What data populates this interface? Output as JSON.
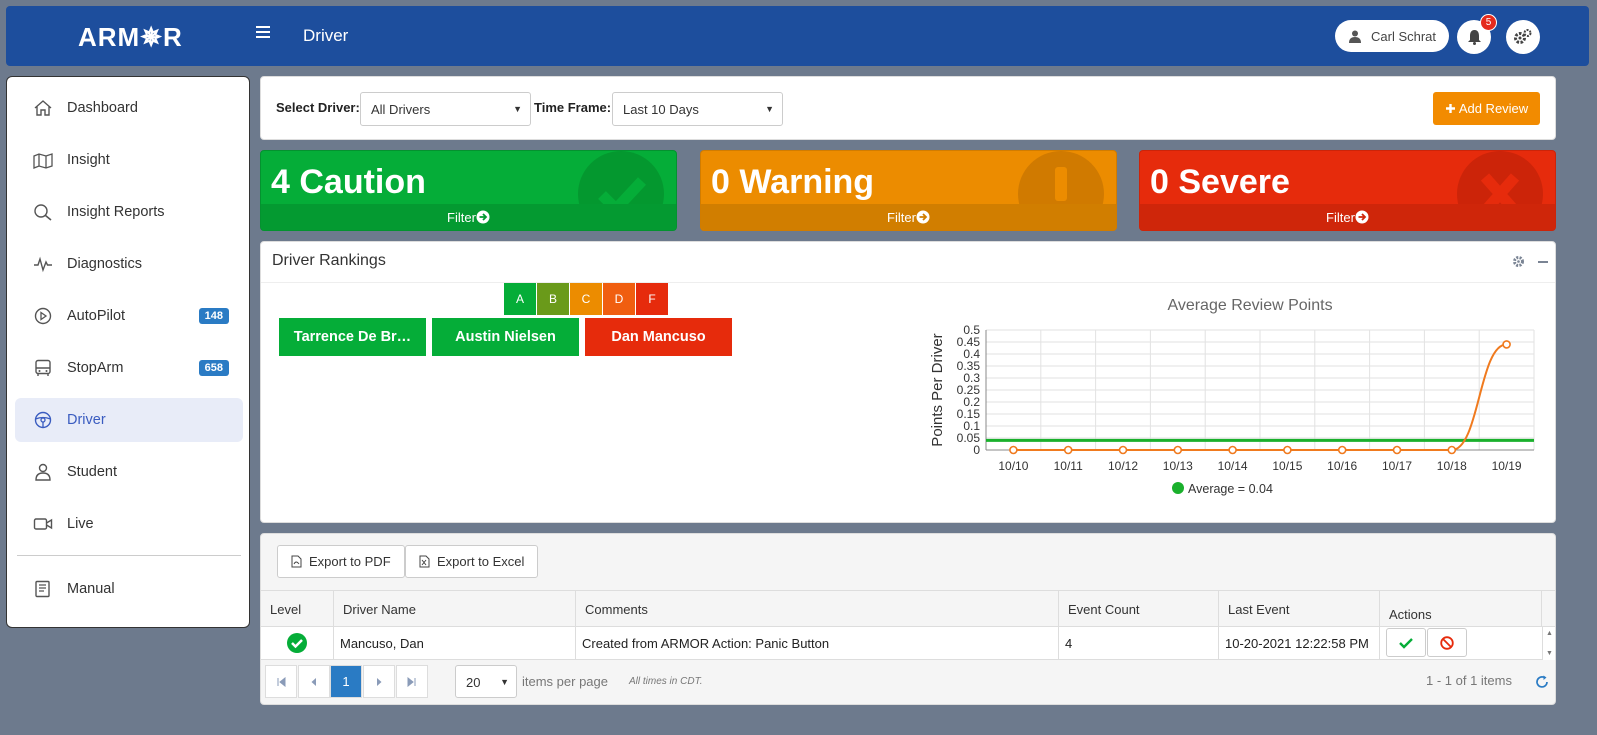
{
  "header": {
    "logo": "ARM✵R",
    "page_title": "Driver",
    "user_name": "Carl Schrat",
    "notification_count": "5"
  },
  "sidebar": {
    "items": [
      {
        "label": "Dashboard",
        "icon": "home-icon"
      },
      {
        "label": "Insight",
        "icon": "map-icon"
      },
      {
        "label": "Insight Reports",
        "icon": "search-icon"
      },
      {
        "label": "Diagnostics",
        "icon": "pulse-icon"
      },
      {
        "label": "AutoPilot",
        "icon": "play-circle-icon",
        "badge": "148"
      },
      {
        "label": "StopArm",
        "icon": "bus-icon",
        "badge": "658"
      },
      {
        "label": "Driver",
        "icon": "steering-wheel-icon",
        "active": true
      },
      {
        "label": "Student",
        "icon": "student-icon"
      },
      {
        "label": "Live",
        "icon": "video-camera-icon"
      },
      {
        "label": "Manual",
        "icon": "book-icon"
      }
    ]
  },
  "filters": {
    "driver_label": "Select Driver:",
    "driver_value": "All Drivers",
    "timeframe_label": "Time Frame:",
    "timeframe_value": "Last 10 Days",
    "add_review": "Add Review"
  },
  "stats": [
    {
      "title": "4 Caution",
      "filter": "Filter",
      "color": "#05ad38",
      "icon": "check-icon"
    },
    {
      "title": "0 Warning",
      "filter": "Filter",
      "color": "#ec8c00",
      "icon": "exclamation-icon"
    },
    {
      "title": "0 Severe",
      "filter": "Filter",
      "color": "#e62b0c",
      "icon": "x-icon"
    }
  ],
  "rankings": {
    "title": "Driver Rankings",
    "grades": [
      "A",
      "B",
      "C",
      "D",
      "F"
    ],
    "grade_colors": [
      "#05ad38",
      "#6a9a1a",
      "#ec8c00",
      "#f05e10",
      "#e62b0c"
    ],
    "drivers": [
      {
        "name": "Tarrence De Br…",
        "color": "#05ad38"
      },
      {
        "name": "Austin Nielsen",
        "color": "#05ad38"
      },
      {
        "name": "Dan Mancuso",
        "color": "#e62b0c"
      }
    ]
  },
  "chart_data": {
    "type": "line",
    "title": "Average Review Points",
    "xlabel": "",
    "ylabel": "Points Per Driver",
    "categories": [
      "10/10",
      "10/11",
      "10/12",
      "10/13",
      "10/14",
      "10/15",
      "10/16",
      "10/17",
      "10/18",
      "10/19"
    ],
    "series": [
      {
        "values": [
          0,
          0,
          0,
          0,
          0,
          0,
          0,
          0,
          0,
          0.44
        ],
        "color": "#f07a1e"
      }
    ],
    "average": {
      "name": "Average = 0.04",
      "value": 0.04,
      "color": "#1ab02c"
    },
    "yticks": [
      "0",
      "0.05",
      "0.1",
      "0.15",
      "0.2",
      "0.25",
      "0.3",
      "0.35",
      "0.4",
      "0.45",
      "0.5"
    ],
    "ylim": [
      0,
      0.5
    ],
    "grid": true,
    "legend": "bottom"
  },
  "table": {
    "export_pdf": "Export to PDF",
    "export_excel": "Export to Excel",
    "columns": [
      "Level",
      "Driver Name",
      "Comments",
      "Event Count",
      "Last Event",
      "Actions"
    ],
    "rows": [
      {
        "driver": "Mancuso, Dan",
        "comments": "Created from ARMOR Action: Panic Button",
        "count": "4",
        "last_event": "10-20-2021 12:22:58 PM"
      }
    ],
    "page": "1",
    "page_size": "20",
    "items_per_page": "items per page",
    "timezone_note": "All times in CDT.",
    "summary": "1 - 1 of 1 items"
  }
}
